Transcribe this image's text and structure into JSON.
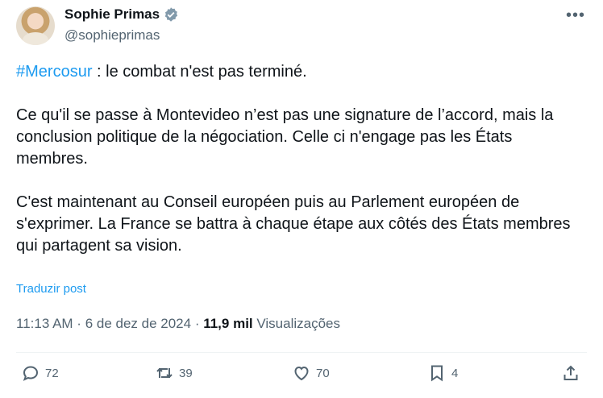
{
  "author": {
    "name": "Sophie Primas",
    "handle": "@sophieprimas"
  },
  "post": {
    "hashtag": "#Mercosur",
    "text_line1_rest": " : le combat n'est pas terminé.",
    "text_body": "\n\nCe qu'il se passe à Montevideo n’est pas une signature de l’accord, mais la conclusion politique de la négociation. Celle ci n'engage pas les États membres.\n\nC'est maintenant au Conseil européen puis au Parlement européen de s'exprimer. La France se battra à chaque étape aux côtés des États membres qui partagent sa vision.",
    "translate_label": "Traduzir post"
  },
  "meta": {
    "time": "11:13 AM",
    "sep1": " · ",
    "date": "6 de dez de 2024",
    "sep2": " · ",
    "views_count": "11,9 mil",
    "views_label": " Visualizações"
  },
  "actions": {
    "replies": "72",
    "reposts": "39",
    "likes": "70",
    "bookmarks": "4"
  },
  "icons": {
    "more": "more-dots-icon",
    "verified": "verified-badge-icon"
  }
}
